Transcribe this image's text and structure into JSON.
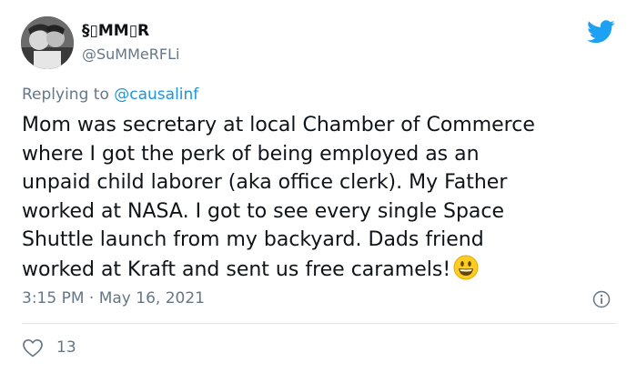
{
  "author": {
    "name": "§▯MM▯R",
    "handle": "@SuMMeRFLi"
  },
  "reply": {
    "prefix": "Replying to",
    "mention": "@causalinf"
  },
  "tweet": {
    "lines": [
      "Mom was secretary at local Chamber of Commerce",
      "where I got the perk of being employed as an",
      "unpaid child laborer (aka office clerk). My Father",
      "worked at NASA. I got to see every single Space",
      "Shuttle launch from my backyard. Dads friend",
      "worked at Kraft and sent us free caramels!"
    ],
    "emoji_icon": "grinning-face-emoji"
  },
  "meta": {
    "timestamp": "3:15 PM · May 16, 2021"
  },
  "engagement": {
    "likes": "13"
  },
  "colors": {
    "brand_blue": "#1da1f2",
    "muted": "#657786",
    "link": "#1b95e0"
  }
}
